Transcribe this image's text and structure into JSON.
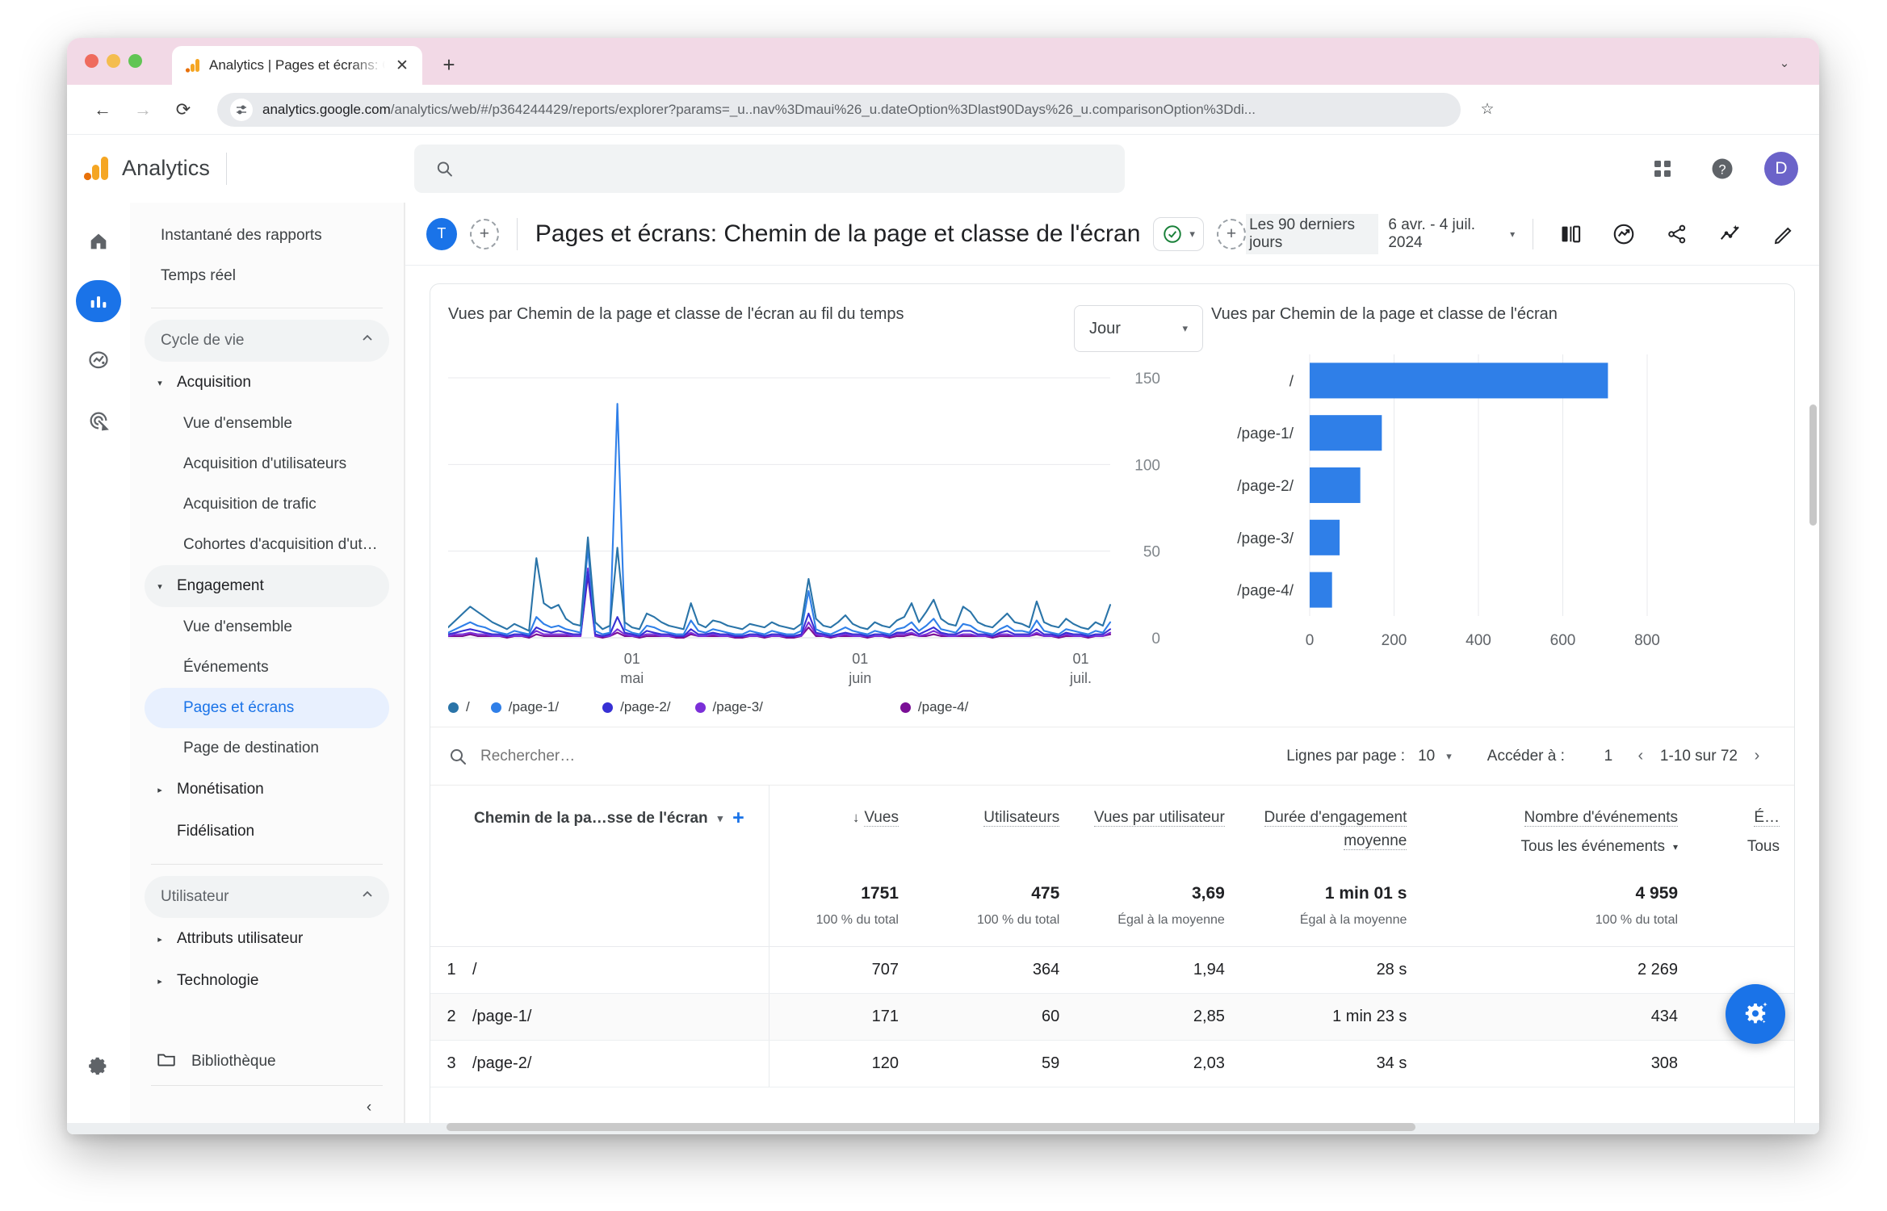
{
  "browser": {
    "tab_title": "Analytics | Pages et écrans: C",
    "favicon_name": "google-analytics-favicon",
    "close_label": "✕",
    "newtab_label": "+",
    "back_label": "←",
    "forward_label": "→",
    "reload_label": "⟳",
    "url_host": "analytics.google.com",
    "url_path": "/analytics/web/#/p364244429/reports/explorer?params=_u..nav%3Dmaui%26_u.dateOption%3Dlast90Days%26_u.comparisonOption%3Ddi...",
    "star_label": "☆",
    "tab_list_label": "⌄"
  },
  "ga_header": {
    "product_name": "Analytics",
    "search_placeholder": "",
    "apps_icon": "apps-grid-icon",
    "help_icon": "help-circle-icon",
    "avatar_initial": "D"
  },
  "rail": {
    "items": [
      {
        "name": "home-icon",
        "label": "Accueil",
        "active": false
      },
      {
        "name": "reports-bar-icon",
        "label": "Rapports",
        "active": true
      },
      {
        "name": "explore-icon",
        "label": "Explorer",
        "active": false
      },
      {
        "name": "advertising-icon",
        "label": "Publicité",
        "active": false
      }
    ],
    "settings_label": "Administration"
  },
  "sidebar": {
    "top_links": [
      {
        "label": "Instantané des rapports"
      },
      {
        "label": "Temps réel"
      }
    ],
    "sections": [
      {
        "label": "Cycle de vie",
        "expanded": true,
        "groups": [
          {
            "label": "Acquisition",
            "expanded": true,
            "children": [
              {
                "label": "Vue d'ensemble",
                "active": false
              },
              {
                "label": "Acquisition d'utilisateurs",
                "active": false
              },
              {
                "label": "Acquisition de trafic",
                "active": false
              },
              {
                "label": "Cohortes d'acquisition d'ut…",
                "active": false
              }
            ]
          },
          {
            "label": "Engagement",
            "expanded": true,
            "selected": true,
            "children": [
              {
                "label": "Vue d'ensemble",
                "active": false
              },
              {
                "label": "Événements",
                "active": false
              },
              {
                "label": "Pages et écrans",
                "active": true
              },
              {
                "label": "Page de destination",
                "active": false
              }
            ]
          },
          {
            "label": "Monétisation",
            "expanded": false,
            "children": []
          },
          {
            "label": "Fidélisation",
            "expanded": null,
            "children": []
          }
        ]
      },
      {
        "label": "Utilisateur",
        "expanded": true,
        "groups": [
          {
            "label": "Attributs utilisateur",
            "expanded": false,
            "children": []
          },
          {
            "label": "Technologie",
            "expanded": false,
            "children": []
          }
        ]
      }
    ],
    "library_label": "Bibliothèque",
    "library_icon": "folder-icon",
    "collapse_label": "‹"
  },
  "report_header": {
    "avatar_letter": "T",
    "add_comparison_label": "+",
    "title": "Pages et écrans: Chemin de la page et classe de l'écran",
    "validity_icon": "check-circle-icon",
    "validity_caret": "▾",
    "add_filter_label": "+",
    "date_preset": "Les 90 derniers jours",
    "date_range": "6 avr. - 4 juil. 2024",
    "date_caret": "▾",
    "icons": [
      {
        "name": "compare-icon"
      },
      {
        "name": "insights-icon"
      },
      {
        "name": "share-icon"
      },
      {
        "name": "trending-sparkle-icon"
      },
      {
        "name": "edit-pencil-icon"
      }
    ]
  },
  "line_chart": {
    "title": "Vues par Chemin de la page et classe de l'écran au fil du temps",
    "granularity": "Jour",
    "granularity_caret": "▾"
  },
  "bar_chart": {
    "title": "Vues par Chemin de la page et classe de l'écran"
  },
  "chart_data": [
    {
      "type": "line",
      "title": "Vues par Chemin de la page et classe de l'écran au fil du temps",
      "xlabel": "",
      "ylabel": "",
      "ylim": [
        0,
        150
      ],
      "yticks": [
        0,
        50,
        100,
        150
      ],
      "xticks": [
        "01 mai",
        "01 juin",
        "01 juil."
      ],
      "grid": true,
      "legend": "bottom",
      "granularity": "Jour",
      "series": [
        {
          "name": "/",
          "color": "#2a74a8",
          "values": [
            6,
            10,
            14,
            18,
            15,
            12,
            9,
            7,
            5,
            8,
            6,
            4,
            46,
            20,
            17,
            19,
            11,
            8,
            7,
            58,
            9,
            5,
            7,
            52,
            9,
            6,
            5,
            14,
            12,
            9,
            7,
            6,
            5,
            20,
            8,
            6,
            10,
            9,
            7,
            6,
            5,
            8,
            7,
            6,
            9,
            7,
            6,
            5,
            8,
            34,
            11,
            7,
            6,
            9,
            13,
            8,
            6,
            5,
            9,
            7,
            6,
            10,
            12,
            20,
            9,
            15,
            22,
            11,
            8,
            7,
            18,
            15,
            9,
            7,
            6,
            10,
            14,
            9,
            8,
            6,
            21,
            9,
            7,
            6,
            11,
            8,
            6,
            5,
            9,
            7,
            19
          ]
        },
        {
          "name": "/page-1/",
          "color": "#2f7fe8",
          "values": [
            3,
            5,
            7,
            9,
            7,
            6,
            4,
            3,
            2,
            4,
            3,
            2,
            12,
            8,
            6,
            7,
            5,
            4,
            3,
            52,
            4,
            2,
            3,
            135,
            5,
            3,
            2,
            7,
            6,
            4,
            3,
            2,
            2,
            10,
            4,
            3,
            5,
            4,
            3,
            2,
            2,
            4,
            3,
            2,
            4,
            3,
            2,
            2,
            4,
            27,
            5,
            3,
            2,
            4,
            6,
            4,
            3,
            2,
            4,
            3,
            2,
            5,
            6,
            9,
            4,
            7,
            11,
            5,
            4,
            3,
            8,
            7,
            4,
            3,
            2,
            5,
            7,
            4,
            4,
            3,
            10,
            4,
            3,
            2,
            5,
            4,
            3,
            2,
            4,
            3,
            9
          ]
        },
        {
          "name": "/page-2/",
          "color": "#3730d4",
          "values": [
            2,
            3,
            4,
            5,
            4,
            3,
            2,
            2,
            1,
            2,
            2,
            1,
            6,
            4,
            3,
            4,
            3,
            2,
            2,
            38,
            2,
            1,
            2,
            12,
            3,
            2,
            1,
            4,
            3,
            2,
            2,
            1,
            1,
            5,
            2,
            2,
            3,
            2,
            2,
            1,
            1,
            2,
            2,
            1,
            2,
            2,
            1,
            1,
            2,
            14,
            3,
            2,
            1,
            2,
            3,
            2,
            2,
            1,
            2,
            2,
            1,
            3,
            3,
            5,
            2,
            4,
            6,
            3,
            2,
            2,
            4,
            4,
            2,
            2,
            1,
            3,
            4,
            2,
            2,
            2,
            5,
            2,
            2,
            1,
            3,
            2,
            2,
            1,
            2,
            2,
            5
          ]
        },
        {
          "name": "/page-3/",
          "color": "#7b2fd8",
          "values": [
            1,
            2,
            2,
            3,
            2,
            2,
            1,
            1,
            1,
            1,
            1,
            1,
            4,
            2,
            2,
            2,
            2,
            1,
            1,
            40,
            1,
            1,
            1,
            5,
            2,
            1,
            1,
            2,
            2,
            1,
            1,
            1,
            1,
            3,
            1,
            1,
            2,
            1,
            1,
            1,
            1,
            1,
            1,
            1,
            1,
            1,
            1,
            1,
            1,
            9,
            2,
            1,
            1,
            1,
            2,
            1,
            1,
            1,
            1,
            1,
            1,
            2,
            2,
            3,
            1,
            2,
            4,
            2,
            1,
            1,
            2,
            2,
            1,
            1,
            1,
            2,
            2,
            1,
            1,
            1,
            3,
            1,
            1,
            1,
            2,
            1,
            1,
            1,
            1,
            1,
            3
          ]
        },
        {
          "name": "/page-4/",
          "color": "#7a0f96",
          "values": [
            1,
            1,
            1,
            2,
            1,
            1,
            1,
            1,
            0,
            1,
            1,
            0,
            2,
            1,
            1,
            1,
            1,
            1,
            1,
            36,
            1,
            0,
            1,
            3,
            1,
            1,
            0,
            1,
            1,
            1,
            1,
            0,
            0,
            2,
            1,
            1,
            1,
            1,
            1,
            0,
            0,
            1,
            1,
            0,
            1,
            1,
            0,
            0,
            1,
            6,
            1,
            1,
            0,
            1,
            1,
            1,
            1,
            0,
            1,
            1,
            0,
            1,
            1,
            2,
            1,
            1,
            2,
            1,
            1,
            1,
            1,
            1,
            1,
            1,
            0,
            1,
            1,
            1,
            1,
            1,
            2,
            1,
            1,
            0,
            1,
            1,
            1,
            0,
            1,
            1,
            2
          ]
        }
      ]
    },
    {
      "type": "bar",
      "orientation": "horizontal",
      "title": "Vues par Chemin de la page et classe de l'écran",
      "categories": [
        "/",
        "/page-1/",
        "/page-2/",
        "/page-3/",
        "/page-4/"
      ],
      "values": [
        707,
        171,
        120,
        71,
        53
      ],
      "xlim": [
        0,
        800
      ],
      "xticks": [
        0,
        200,
        400,
        600,
        800
      ],
      "bar_color": "#2f7fe8",
      "grid": true
    }
  ],
  "table_toolbar": {
    "search_placeholder": "Rechercher…",
    "search_icon": "search-icon",
    "rows_per_page_label": "Lignes par page :",
    "rows_per_page_value": "10",
    "rows_caret": "▾",
    "goto_label": "Accéder à :",
    "goto_value": "1",
    "prev_label": "‹",
    "range_label": "1-10 sur 72",
    "next_label": "›"
  },
  "table": {
    "dimension_header": "Chemin de la pa…sse de l'écran",
    "dimension_caret": "▾",
    "add_dimension_label": "+",
    "columns": [
      {
        "label": "Vues",
        "sorted": true,
        "sort_icon": "↓"
      },
      {
        "label": "Utilisateurs"
      },
      {
        "label": "Vues par utilisateur"
      },
      {
        "label": "Durée d'engagement moyenne"
      },
      {
        "label": "Nombre d'événements",
        "sub_select": "Tous les événements",
        "sub_caret": "▾"
      },
      {
        "label": "É…",
        "sub_select": "Tous"
      }
    ],
    "totals": [
      {
        "value": "1751",
        "sub": "100 % du total"
      },
      {
        "value": "475",
        "sub": "100 % du total"
      },
      {
        "value": "3,69",
        "sub": "Égal à la moyenne"
      },
      {
        "value": "1 min 01 s",
        "sub": "Égal à la moyenne"
      },
      {
        "value": "4 959",
        "sub": "100 % du total"
      }
    ],
    "rows": [
      {
        "rank": "1",
        "path": "/",
        "views": "707",
        "users": "364",
        "views_per_user": "1,94",
        "avg_engagement": "28 s",
        "events": "2 269"
      },
      {
        "rank": "2",
        "path": "/page-1/",
        "views": "171",
        "users": "60",
        "views_per_user": "2,85",
        "avg_engagement": "1 min 23 s",
        "events": "434"
      },
      {
        "rank": "3",
        "path": "/page-2/",
        "views": "120",
        "users": "59",
        "views_per_user": "2,03",
        "avg_engagement": "34 s",
        "events": "308"
      }
    ]
  },
  "fab": {
    "icon": "ai-gear-sparkle-icon",
    "label": "Insights"
  },
  "colors": {
    "accent": "#1a73e8",
    "bar": "#2f7fe8",
    "tab_strip": "#f2d9e6",
    "avatar": "#6b63c9"
  }
}
